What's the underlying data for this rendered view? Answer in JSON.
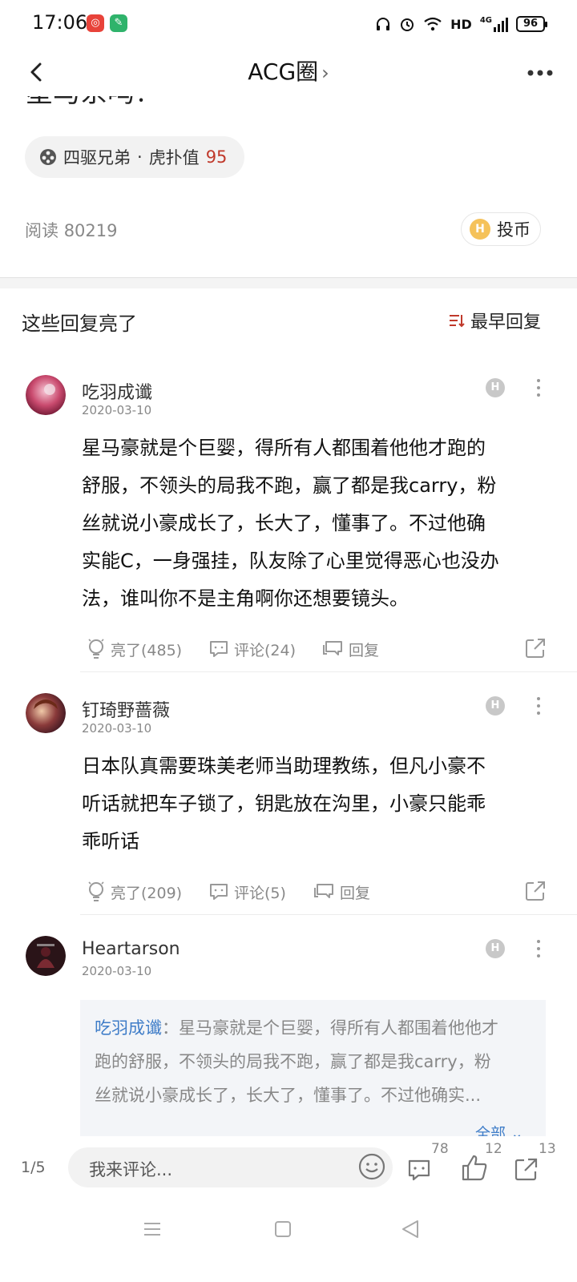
{
  "status_bar": {
    "time": "17:06",
    "network": "HD",
    "signal_type": "4G",
    "battery": "96",
    "icons": [
      "headphones-icon",
      "alarm-icon",
      "wifi-icon",
      "signal-icon",
      "battery-icon"
    ]
  },
  "header": {
    "title": "ACG圈",
    "title_chevron": "›"
  },
  "post": {
    "cut_title": "星马系吗？",
    "author_chip": {
      "name": "四驱兄弟",
      "separator": "·",
      "score_label": "虎扑值",
      "score": "95"
    },
    "reads_label": "阅读",
    "reads_count": "80219",
    "coin_label": "投币"
  },
  "replies": {
    "section_title": "这些回复亮了",
    "sort_label": "最早回复"
  },
  "comments": [
    {
      "username": "吃羽成谶",
      "date": "2020-03-10",
      "badge": "H",
      "lines": [
        "星马豪就是个巨婴，得所有人都围着他他才跑的",
        "舒服，不领头的局我不跑，赢了都是我carry，粉",
        "丝就说小豪成长了，长大了，懂事了。不过他确",
        "实能C，一身强挂，队友除了心里觉得恶心也没办",
        "法，谁叫你不是主角啊你还想要镜头。"
      ],
      "light_label": "亮了(485)",
      "comment_label": "评论(24)",
      "reply_label": "回复"
    },
    {
      "username": "钉琦野蔷薇",
      "date": "2020-03-10",
      "badge": "H",
      "lines": [
        "日本队真需要珠美老师当助理教练，但凡小豪不",
        "听话就把车子锁了，钥匙放在沟里，小豪只能乖",
        "乖听话"
      ],
      "light_label": "亮了(209)",
      "comment_label": "评论(5)",
      "reply_label": "回复"
    },
    {
      "username": "Heartarson",
      "date": "2020-03-10",
      "badge": "H",
      "quote": {
        "user": "吃羽成谶",
        "sep": "：",
        "line1": "星马豪就是个巨婴，得所有人都围着他他才",
        "line2": "跑的舒服，不领头的局我不跑，赢了都是我carry，粉",
        "line3": "丝就说小豪成长了，长大了，懂事了。不过他确实...",
        "more": "全部 ⌄"
      }
    }
  ],
  "bottom_bar": {
    "page": "1/5",
    "input_placeholder": "我来评论...",
    "comments_count": "78",
    "likes_count": "12",
    "shares_count": "13"
  },
  "colors": {
    "accent_red": "#c0392b",
    "link_blue": "#3f7dc8",
    "coin_yellow": "#f5c25a"
  }
}
